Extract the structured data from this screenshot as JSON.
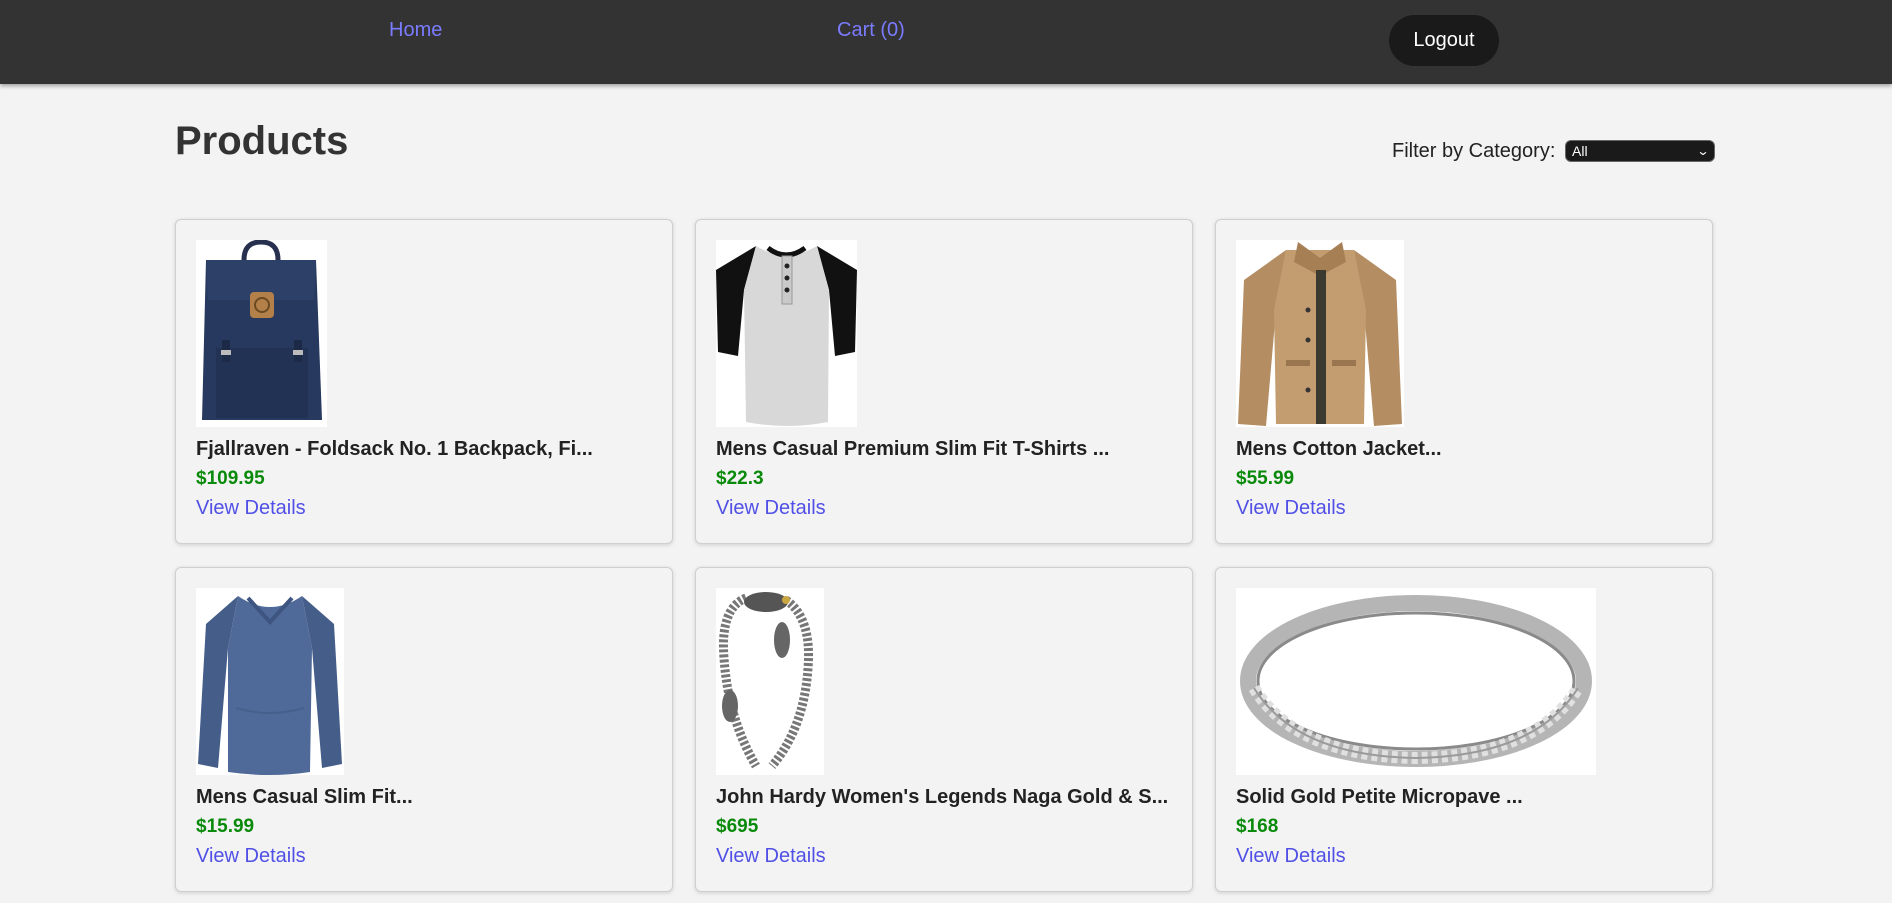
{
  "nav": {
    "home_label": "Home",
    "cart_label": "Cart (0)",
    "logout_label": "Logout"
  },
  "page": {
    "title": "Products"
  },
  "filter": {
    "label": "Filter by Category:",
    "selected": "All"
  },
  "colors": {
    "navbar_bg": "#333333",
    "nav_link": "#7b7bff",
    "price": "#0a8a0a",
    "details_link": "#5050e6",
    "page_bg": "#f3f3f3"
  },
  "products": [
    {
      "name": "Fjallraven - Foldsack No. 1 Backpack, Fi...",
      "price": "$109.95",
      "details_label": "View Details",
      "image": "backpack-image"
    },
    {
      "name": "Mens Casual Premium Slim Fit T-Shirts ...",
      "price": "$22.3",
      "details_label": "View Details",
      "image": "tshirt-image"
    },
    {
      "name": "Mens Cotton Jacket...",
      "price": "$55.99",
      "details_label": "View Details",
      "image": "jacket-image"
    },
    {
      "name": "Mens Casual Slim Fit...",
      "price": "$15.99",
      "details_label": "View Details",
      "image": "longsleeve-image"
    },
    {
      "name": "John Hardy Women's Legends Naga Gold & S...",
      "price": "$695",
      "details_label": "View Details",
      "image": "bracelet-image"
    },
    {
      "name": "Solid Gold Petite Micropave ...",
      "price": "$168",
      "details_label": "View Details",
      "image": "ring-image"
    }
  ]
}
